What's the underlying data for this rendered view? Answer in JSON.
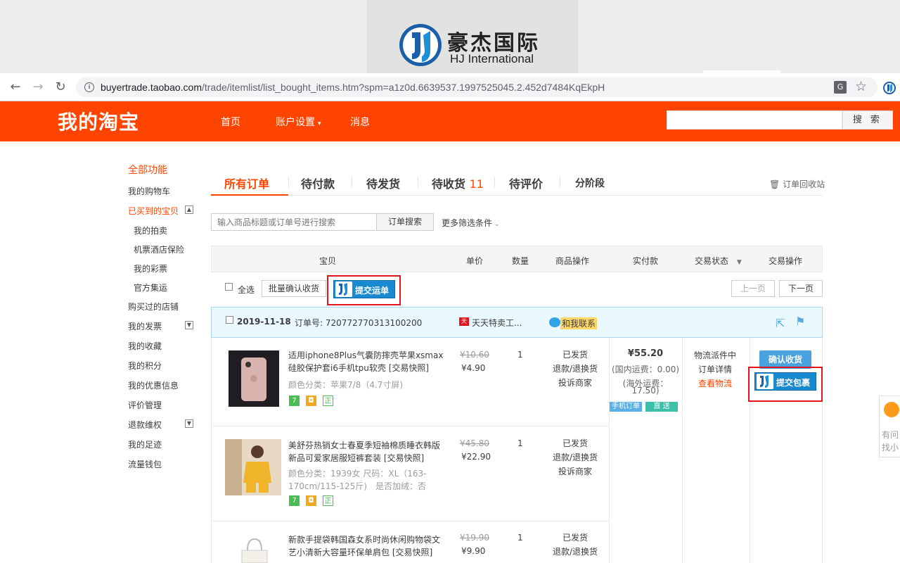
{
  "banner": {
    "brand_cn": "豪杰国际",
    "brand_en": "HJ International"
  },
  "browser": {
    "url_host": "buyertrade.taobao.com",
    "url_path": "/trade/itemlist/list_bought_items.htm?spm=a1z0d.6639537.1997525045.2.452d7484KqEkpH"
  },
  "header": {
    "brand": "我的淘宝",
    "nav": [
      "首页",
      "账户设置",
      "消息"
    ],
    "search_label": "搜 索"
  },
  "sidebar": {
    "title": "全部功能",
    "items": [
      "我的购物车",
      "已买到的宝贝",
      "我的拍卖",
      "机票酒店保险",
      "我的彩票",
      "官方集运",
      "购买过的店铺",
      "我的发票",
      "我的收藏",
      "我的积分",
      "我的优惠信息",
      "评价管理",
      "退款维权",
      "我的足迹",
      "流量钱包"
    ]
  },
  "tabs": {
    "items": [
      "所有订单",
      "待付款",
      "待发货",
      "待收货",
      "待评价",
      "分阶段"
    ],
    "pending_count": "11",
    "recycle": "订单回收站"
  },
  "filter": {
    "search_placeholder": "输入商品标题或订单号进行搜索",
    "search_button": "订单搜索",
    "more": "更多筛选条件"
  },
  "table_header": [
    "宝贝",
    "单价",
    "数量",
    "商品操作",
    "实付款",
    "交易状态",
    "交易操作"
  ],
  "toolbar": {
    "select_all": "全选",
    "batch_confirm": "批量确认收货",
    "submit_waybill": "提交运单",
    "prev_page": "上一页",
    "next_page": "下一页"
  },
  "order": {
    "date": "2019-11-18",
    "order_no": "订单号: 720772770313100200",
    "shop": "天天特卖工...",
    "contact": "和我联系",
    "total": "¥55.20",
    "domestic_shipping": "(国内运费：0.00)",
    "overseas_shipping_1": "(海外运费：",
    "overseas_shipping_2": "17.50)",
    "tag_mobile": "手机订单",
    "tag_direct": "直 送",
    "status_1": "物流派件中",
    "status_2": "订单详情",
    "status_3": "查看物流",
    "confirm": "确认收货",
    "submit_package": "提交包裹",
    "items": [
      {
        "title": "适用iphone8Plus气囊防摔壳苹果xsmax硅胶保护套i6手机tpu软壳 [交易快照]",
        "sku": "颜色分类：苹果7/8（4.7寸屏)",
        "old_price": "¥10.60",
        "price": "¥4.90",
        "qty": "1",
        "op1": "已发货",
        "op2": "退款/退换货",
        "op3": "投诉商家"
      },
      {
        "title": "美舒芬热销女士春夏季短袖棉质睡衣韩版新品可爱家居服短裤套装 [交易快照]",
        "sku": "颜色分类：1939女  尺码：XL（163-170cm/115-125斤)　是否加绒：否",
        "old_price": "¥45.80",
        "price": "¥22.90",
        "qty": "1",
        "op1": "已发货",
        "op2": "退款/退换货",
        "op3": "投诉商家"
      },
      {
        "title": "新款手提袋韩国森女系时尚休闲购物袋文艺小清新大容量环保单肩包 [交易快照]",
        "sku": "",
        "old_price": "¥19.90",
        "price": "¥9.90",
        "qty": "1",
        "op1": "已发货",
        "op2": "退款/退换货",
        "op3": ""
      }
    ]
  },
  "help_tab": [
    "有问",
    "找小"
  ],
  "colors": {
    "taobao_orange": "#ff4400",
    "hj_blue": "#1a8ad0",
    "highlight_red": "#e3151c",
    "order_head_bg": "#eaf8ff"
  },
  "icons": [
    "back-icon",
    "forward-icon",
    "reload-icon",
    "info-icon",
    "translate-icon",
    "star-icon",
    "hj-extension-icon",
    "trash-icon",
    "share-icon",
    "flag-icon",
    "tmall-icon",
    "wangwang-icon"
  ]
}
